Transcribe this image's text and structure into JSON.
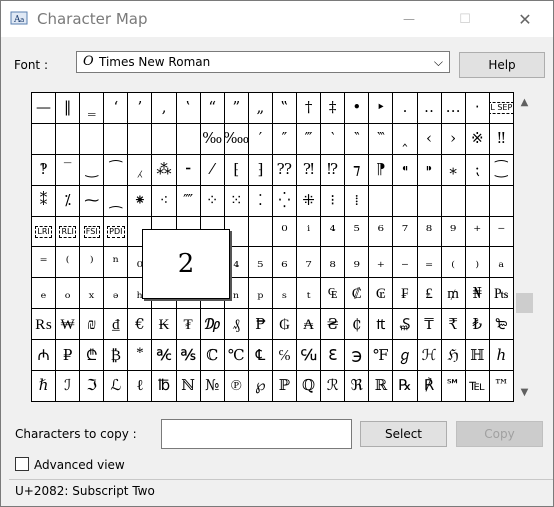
{
  "window": {
    "title": "Character Map",
    "minimize_glyph": "—",
    "maximize_glyph": "☐",
    "close_glyph": "✕"
  },
  "font_row": {
    "label": "Font :",
    "selected_font": "Times New Roman",
    "font_type_glyph": "O",
    "dropdown_glyph": "⌵",
    "help_label": "Help"
  },
  "grid": {
    "cells": [
      "—",
      "‖",
      "‗",
      "‘",
      "’",
      "‚",
      "‛",
      "“",
      "”",
      "„",
      "‟",
      "†",
      "‡",
      "•",
      "‣",
      "․",
      "‥",
      "…",
      "‧",
      "L SEP",
      "",
      "",
      "",
      "",
      "",
      "",
      "",
      "‰",
      "‱",
      "′",
      "″",
      "‴",
      "‵",
      "‶",
      "‷",
      "‸",
      "‹",
      "›",
      "※",
      "‼",
      "‽",
      "‾",
      "‿",
      "⁀",
      "⁁",
      "⁂",
      "⁃",
      "⁄",
      "⁅",
      "⁆",
      "⁇",
      "⁈",
      "⁉",
      "⁊",
      "⁋",
      "⁌",
      "⁍",
      "⁎",
      "⁏",
      "⁐",
      "⁑",
      "⁒",
      "⁓",
      "⁔",
      "⁕",
      "⁖",
      "⁗",
      "⁘",
      "⁙",
      "⁚",
      "⁛",
      "⁜",
      "⁝",
      "⁞",
      "",
      "",
      "",
      "",
      "",
      "",
      "LRI",
      "RLI",
      "FSI",
      "PDI",
      "",
      "",
      "",
      "",
      "",
      "",
      "⁰",
      "ⁱ",
      "⁴",
      "⁵",
      "⁶",
      "⁷",
      "⁸",
      "⁹",
      "⁺",
      "⁻",
      "⁼",
      "⁽",
      "⁾",
      "ⁿ",
      "₀",
      "₁",
      "₂",
      "₃",
      "₄",
      "₅",
      "₆",
      "₇",
      "₈",
      "₉",
      "₊",
      "₋",
      "₌",
      "₍",
      "₎",
      "ₐ",
      "ₑ",
      "ₒ",
      "ₓ",
      "ₔ",
      "ₕ",
      "ₖ",
      "ₗ",
      "ₘ",
      "ₙ",
      "ₚ",
      "ₛ",
      "ₜ",
      "₠",
      "₡",
      "₢",
      "₣",
      "₤",
      "₥",
      "₦",
      "₧",
      "₨",
      "₩",
      "₪",
      "₫",
      "€",
      "₭",
      "₮",
      "₯",
      "₰",
      "₱",
      "₲",
      "₳",
      "₴",
      "₵",
      "₶",
      "₷",
      "₸",
      "₹",
      "₺",
      "₻",
      "₼",
      "₽",
      "₾",
      "₿",
      "⃰",
      "℀",
      "℁",
      "ℂ",
      "℃",
      "℄",
      "℅",
      "℆",
      "ℇ",
      "℈",
      "℉",
      "ℊ",
      "ℋ",
      "ℌ",
      "ℍ",
      "ℎ",
      "ℏ",
      "ℐ",
      "ℑ",
      "ℒ",
      "ℓ",
      "℔",
      "ℕ",
      "№",
      "℗",
      "℘",
      "ℙ",
      "ℚ",
      "ℛ",
      "ℜ",
      "ℝ",
      "℞",
      "℟",
      "℠",
      "℡",
      "™"
    ],
    "magnified_char": "2"
  },
  "scrollbar": {
    "up_glyph": "▲",
    "down_glyph": "▼"
  },
  "copy_row": {
    "label": "Characters to copy :",
    "value": "",
    "select_label": "Select",
    "copy_label": "Copy"
  },
  "advanced": {
    "label": "Advanced view",
    "checked": false
  },
  "status": {
    "text": "U+2082: Subscript Two"
  }
}
